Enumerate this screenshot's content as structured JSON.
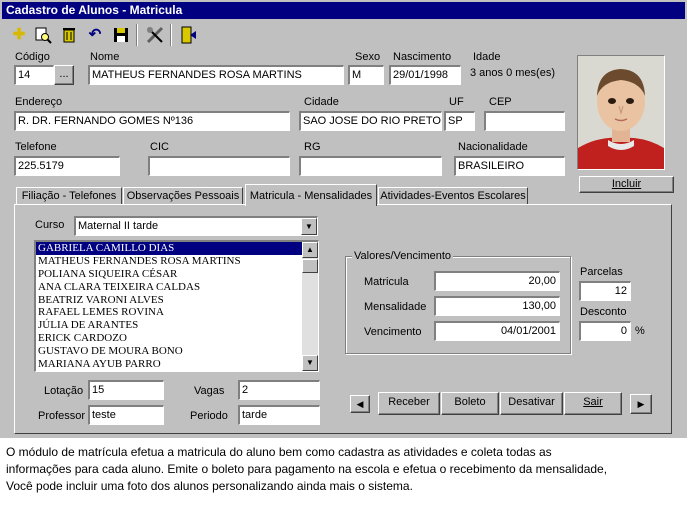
{
  "window": {
    "title": "Cadastro de Alunos - Matricula"
  },
  "toolbar": {
    "icons": [
      "new-icon",
      "search-icon",
      "delete-icon",
      "undo-icon",
      "save-icon",
      "tools-icon",
      "exit-icon"
    ]
  },
  "form": {
    "codigo_label": "Código",
    "codigo_value": "14",
    "lookup_label": "...",
    "nome_label": "Nome",
    "nome_value": "MATHEUS FERNANDES ROSA MARTINS",
    "sexo_label": "Sexo",
    "sexo_value": "M",
    "nascimento_label": "Nascimento",
    "nascimento_value": "29/01/1998",
    "idade_label": "Idade",
    "idade_value": "3 anos 0 mes(es)",
    "endereco_label": "Endereço",
    "endereco_value": "R. DR. FERNANDO GOMES Nº136",
    "cidade_label": "Cidade",
    "cidade_value": "SAO JOSE DO RIO PRETO",
    "uf_label": "UF",
    "uf_value": "SP",
    "cep_label": "CEP",
    "cep_value": "",
    "telefone_label": "Telefone",
    "telefone_value": "225.5179",
    "cic_label": "CIC",
    "cic_value": "",
    "rg_label": "RG",
    "rg_value": "",
    "nacionalidade_label": "Nacionalidade",
    "nacionalidade_value": "BRASILEIRO",
    "incluir_label": "Incluir"
  },
  "tabs": [
    {
      "label": "Filiação - Telefones"
    },
    {
      "label": "Observações Pessoais"
    },
    {
      "label": "Matricula - Mensalidades"
    },
    {
      "label": "Atividades-Eventos Escolares"
    }
  ],
  "matricula": {
    "curso_label": "Curso",
    "curso_value": "Maternal II tarde",
    "students": [
      "GABRIELA CAMILLO DIAS",
      "MATHEUS FERNANDES ROSA MARTINS",
      "POLIANA SIQUEIRA CÉSAR",
      "ANA CLARA TEIXEIRA CALDAS",
      "BEATRIZ VARONI ALVES",
      "RAFAEL LEMES ROVINA",
      "JÚLIA DE ARANTES",
      "ERICK CARDOZO",
      "GUSTAVO DE MOURA BONO",
      "MARIANA AYUB PARRO"
    ],
    "selected_index": 0,
    "lotacao_label": "Lotação",
    "lotacao_value": "15",
    "vagas_label": "Vagas",
    "vagas_value": "2",
    "professor_label": "Professor",
    "professor_value": "teste",
    "periodo_label": "Periodo",
    "periodo_value": "tarde"
  },
  "valores": {
    "group_title": "Valores/Vencimento",
    "matricula_label": "Matricula",
    "matricula_value": "20,00",
    "mensalidade_label": "Mensalidade",
    "mensalidade_value": "130,00",
    "vencimento_label": "Vencimento",
    "vencimento_value": "04/01/2001",
    "parcelas_label": "Parcelas",
    "parcelas_value": "12",
    "desconto_label": "Desconto",
    "desconto_value": "0",
    "percent": "%"
  },
  "actions": {
    "prev": "◀",
    "receber": "Receber",
    "boleto": "Boleto",
    "desativar": "Desativar",
    "sair": "Sair",
    "next": "▶"
  },
  "caption": {
    "line1": "O módulo de matrícula efetua a matricula do aluno bem como cadastra as atividades e coleta todas as",
    "line2": "informações para cada aluno. Emite o boleto para pagamento na escola e efetua o recebimento da mensalidade,",
    "line3": "Você pode incluir uma foto dos alunos personalizando ainda mais o sistema."
  }
}
